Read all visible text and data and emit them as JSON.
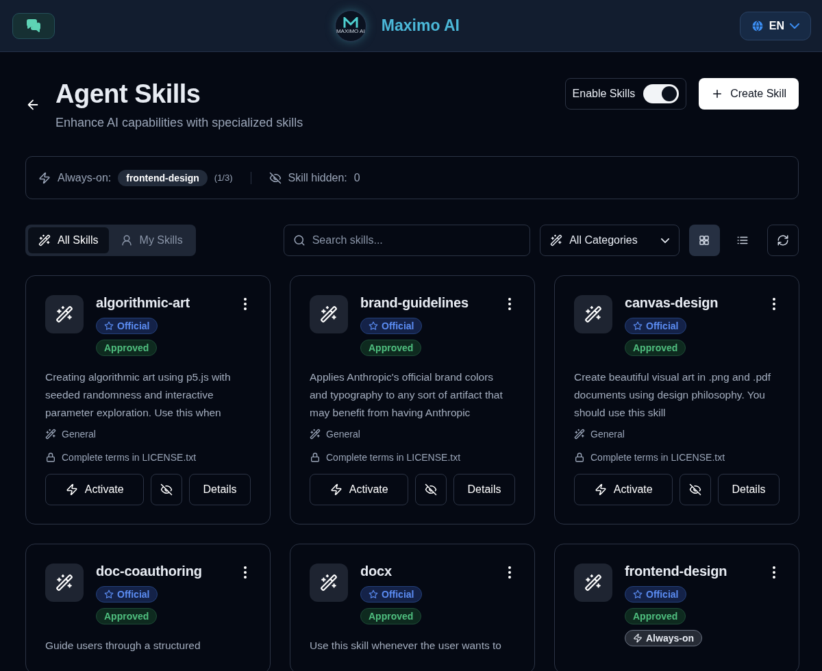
{
  "header": {
    "brand": "Maximo AI",
    "logo_text": "MAXIMO AI",
    "language": "EN"
  },
  "page": {
    "title": "Agent Skills",
    "subtitle": "Enhance AI capabilities with specialized skills",
    "enable_label": "Enable Skills",
    "enabled": true,
    "create_label": "Create Skill"
  },
  "info_bar": {
    "always_on_label": "Always-on:",
    "always_on_skill": "frontend-design",
    "always_on_count": "(1/3)",
    "hidden_label": "Skill hidden:",
    "hidden_count": "0"
  },
  "tabs": [
    {
      "label": "All Skills",
      "kind": "wand",
      "selected": true
    },
    {
      "label": "My Skills",
      "kind": "user",
      "selected": false
    }
  ],
  "search": {
    "placeholder": "Search skills..."
  },
  "category_filter": {
    "value": "All Categories"
  },
  "views": [
    {
      "kind": "grid",
      "selected": true
    },
    {
      "kind": "list",
      "selected": false
    }
  ],
  "cards": [
    {
      "name": "algorithmic-art",
      "badges": [
        {
          "kind": "official",
          "label": "Official"
        },
        {
          "kind": "approved",
          "label": "Approved"
        }
      ],
      "description": "Creating algorithmic art using p5.js with seeded randomness and interactive parameter exploration. Use this when",
      "category": "General",
      "license": "Complete terms in LICENSE.txt",
      "activate": "Activate",
      "details": "Details"
    },
    {
      "name": "brand-guidelines",
      "badges": [
        {
          "kind": "official",
          "label": "Official"
        },
        {
          "kind": "approved",
          "label": "Approved"
        }
      ],
      "description": "Applies Anthropic's official brand colors and typography to any sort of artifact that may benefit from having Anthropic",
      "category": "General",
      "license": "Complete terms in LICENSE.txt",
      "activate": "Activate",
      "details": "Details"
    },
    {
      "name": "canvas-design",
      "badges": [
        {
          "kind": "official",
          "label": "Official"
        },
        {
          "kind": "approved",
          "label": "Approved"
        }
      ],
      "description": "Create beautiful visual art in .png and .pdf documents using design philosophy. You should use this skill",
      "category": "General",
      "license": "Complete terms in LICENSE.txt",
      "activate": "Activate",
      "details": "Details"
    },
    {
      "name": "doc-coauthoring",
      "badges": [
        {
          "kind": "official",
          "label": "Official"
        },
        {
          "kind": "approved",
          "label": "Approved"
        }
      ],
      "description": "Guide users through a structured"
    },
    {
      "name": "docx",
      "badges": [
        {
          "kind": "official",
          "label": "Official"
        },
        {
          "kind": "approved",
          "label": "Approved"
        }
      ],
      "description": "Use this skill whenever the user wants to"
    },
    {
      "name": "frontend-design",
      "badges": [
        {
          "kind": "official",
          "label": "Official"
        },
        {
          "kind": "approved",
          "label": "Approved"
        },
        {
          "kind": "always-on",
          "label": "Always-on"
        }
      ]
    }
  ]
}
